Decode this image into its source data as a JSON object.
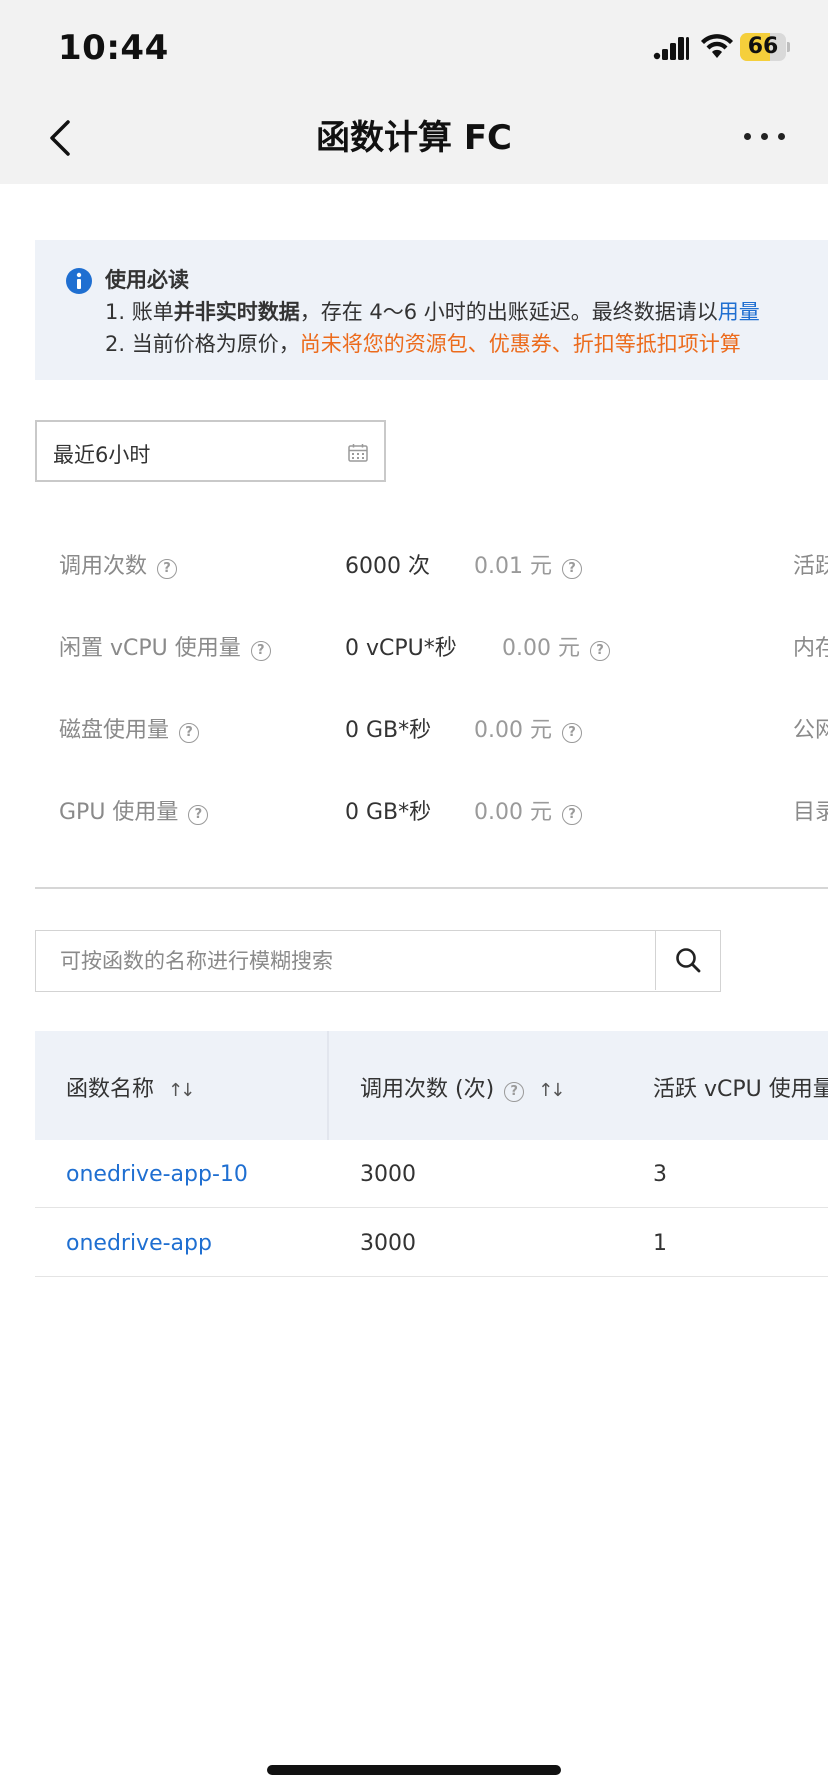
{
  "status": {
    "time": "10:44",
    "battery": "66",
    "battery_level": 0.66
  },
  "nav": {
    "title": "函数计算 FC"
  },
  "notice": {
    "title": "使用必读",
    "line1_prefix": "1. 账单",
    "line1_bold": "并非实时数据",
    "line1_mid": "，存在 4～6 小时的出账延迟。最终数据请以",
    "line1_link": "用量",
    "line2_prefix": "2. 当前价格为原价，",
    "line2_orange": "尚未将您的资源包、优惠券、折扣等抵扣项计算"
  },
  "date_range": {
    "value": "最近6小时"
  },
  "metrics": [
    {
      "label": "调用次数",
      "value": "6000 次",
      "cost": "0.01 元",
      "right": "活跃"
    },
    {
      "label": "闲置 vCPU 使用量",
      "value": "0 vCPU*秒",
      "cost": "0.00 元",
      "right": "内存"
    },
    {
      "label": "磁盘使用量",
      "value": "0 GB*秒",
      "cost": "0.00 元",
      "right": "公网"
    },
    {
      "label": "GPU 使用量",
      "value": "0 GB*秒",
      "cost": "0.00 元",
      "right": "目录"
    }
  ],
  "search": {
    "placeholder": "可按函数的名称进行模糊搜索"
  },
  "table": {
    "columns": [
      {
        "label": "函数名称",
        "sort": "↑↓"
      },
      {
        "label": "调用次数 (次)",
        "sort": "↑↓"
      },
      {
        "label": "活跃 vCPU 使用量"
      }
    ],
    "rows": [
      {
        "name": "onedrive-app-10",
        "invocations": "3000",
        "vcpu": "3"
      },
      {
        "name": "onedrive-app",
        "invocations": "3000",
        "vcpu": "1"
      }
    ]
  }
}
